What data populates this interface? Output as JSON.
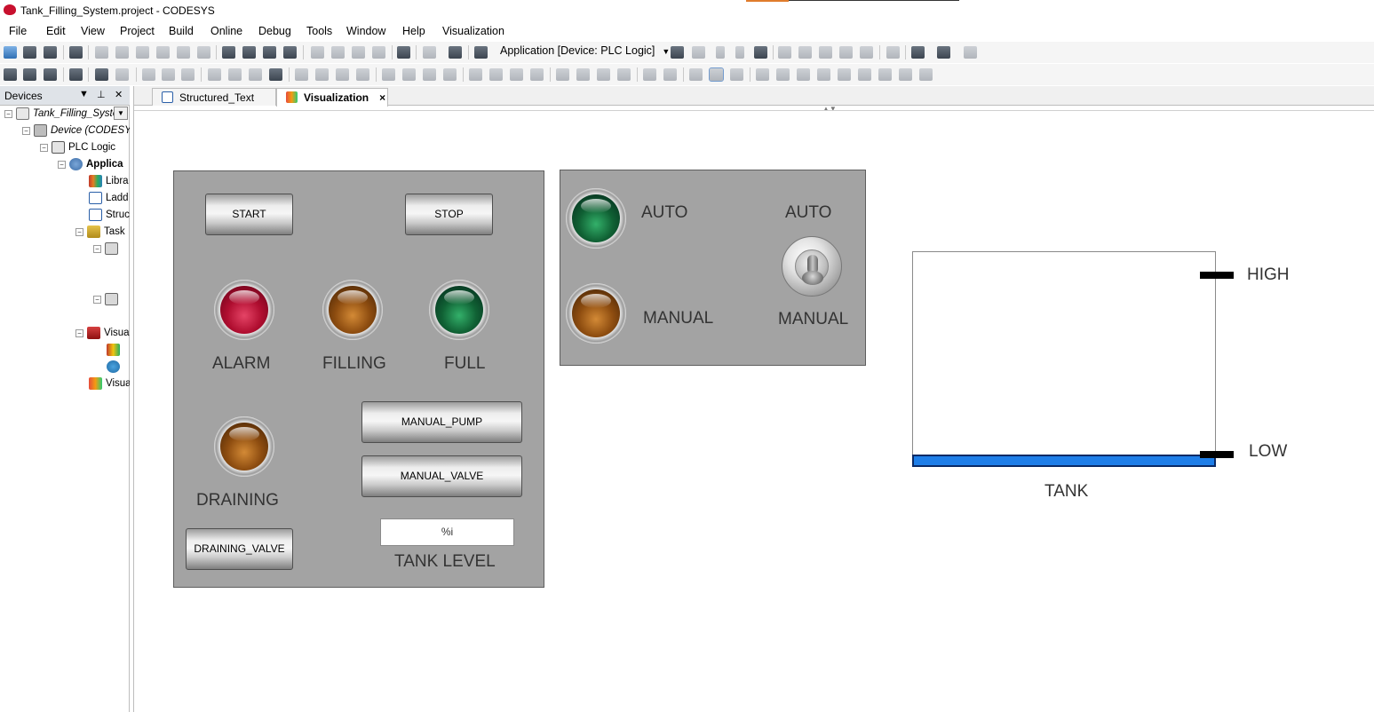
{
  "window": {
    "title": "Tank_Filling_System.project - CODESYS"
  },
  "menu": [
    "File",
    "Edit",
    "View",
    "Project",
    "Build",
    "Online",
    "Debug",
    "Tools",
    "Window",
    "Help",
    "Visualization"
  ],
  "toolbar": {
    "application_combo": "Application [Device: PLC Logic]"
  },
  "devices_panel": {
    "title": "Devices",
    "tree": [
      {
        "label": "Tank_Filling_Syste",
        "italic": true
      },
      {
        "label": "Device (CODESYS",
        "italic": true
      },
      {
        "label": "PLC Logic"
      },
      {
        "label": "Applica",
        "bold": true
      },
      {
        "label": "Libra"
      },
      {
        "label": "Ladd"
      },
      {
        "label": "Struc"
      },
      {
        "label": "Task"
      },
      {
        "label": ""
      },
      {
        "label": ""
      },
      {
        "label": ""
      },
      {
        "label": ""
      },
      {
        "label": "Visua"
      },
      {
        "label": ""
      },
      {
        "label": ""
      },
      {
        "label": "Visua"
      }
    ]
  },
  "tabs": [
    {
      "label": "Structured_Text",
      "active": false
    },
    {
      "label": "Visualization",
      "active": true,
      "close": "×"
    }
  ],
  "control_panel": {
    "start": "START",
    "stop": "STOP",
    "alarm": "ALARM",
    "filling": "FILLING",
    "full": "FULL",
    "draining": "DRAINING",
    "manual_pump": "MANUAL_PUMP",
    "manual_valve": "MANUAL_VALVE",
    "draining_valve": "DRAINING_VALVE",
    "tank_level_value": "%i",
    "tank_level": "TANK LEVEL"
  },
  "mode_panel": {
    "auto_lamp": "AUTO",
    "manual_lamp": "MANUAL",
    "auto_switch": "AUTO",
    "manual_switch": "MANUAL"
  },
  "tank": {
    "high": "HIGH",
    "low": "LOW",
    "label": "TANK"
  },
  "colors": {
    "panel": "#a3a3a3",
    "water": "#1e7ee8",
    "lamp_alarm": "#b00e30",
    "lamp_filling": "#8e4d10",
    "lamp_full": "#106134"
  }
}
